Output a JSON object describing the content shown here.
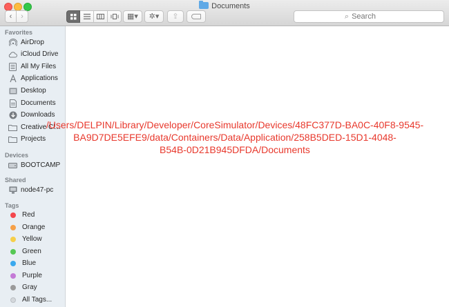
{
  "window": {
    "title": "Documents"
  },
  "toolbar": {
    "back_glyph": "‹",
    "forward_glyph": "›",
    "view_modes": [
      "icon-view",
      "list-view",
      "column-view",
      "cover-flow-view"
    ],
    "arrange_glyph": "▦▾",
    "action_glyph": "✲▾",
    "share_glyph": "⇪"
  },
  "search": {
    "placeholder": "Search"
  },
  "sidebar": {
    "favorites_heading": "Favorites",
    "favorites": [
      {
        "label": "AirDrop",
        "icon": "airdrop-icon"
      },
      {
        "label": "iCloud Drive",
        "icon": "cloud-icon"
      },
      {
        "label": "All My Files",
        "icon": "all-files-icon"
      },
      {
        "label": "Applications",
        "icon": "applications-icon"
      },
      {
        "label": "Desktop",
        "icon": "desktop-icon"
      },
      {
        "label": "Documents",
        "icon": "documents-icon"
      },
      {
        "label": "Downloads",
        "icon": "downloads-icon"
      },
      {
        "label": "Creative Cl...",
        "icon": "folder-icon"
      },
      {
        "label": "Projects",
        "icon": "folder-icon"
      }
    ],
    "devices_heading": "Devices",
    "devices": [
      {
        "label": "BOOTCAMP",
        "icon": "drive-icon"
      }
    ],
    "shared_heading": "Shared",
    "shared": [
      {
        "label": "node47-pc",
        "icon": "computer-icon"
      }
    ],
    "tags_heading": "Tags",
    "tags": [
      {
        "label": "Red",
        "color": "#f4474d"
      },
      {
        "label": "Orange",
        "color": "#f6a047"
      },
      {
        "label": "Yellow",
        "color": "#f6cf4a"
      },
      {
        "label": "Green",
        "color": "#56c854"
      },
      {
        "label": "Blue",
        "color": "#3aa9ee"
      },
      {
        "label": "Purple",
        "color": "#c47ad6"
      },
      {
        "label": "Gray",
        "color": "#9a9a9a"
      },
      {
        "label": "All Tags...",
        "color": "#d4d8dc"
      }
    ]
  },
  "content": {
    "path_text": "/Users/DELPIN/Library/Developer/CoreSimulator/Devices/48FC377D-BA0C-40F8-9545-\nBA9D7DE5EFE9/data/Containers/Data/Application/258B5DED-15D1-4048-\nB54B-0D21B945DFDA/Documents",
    "path_color": "#e8382c"
  }
}
